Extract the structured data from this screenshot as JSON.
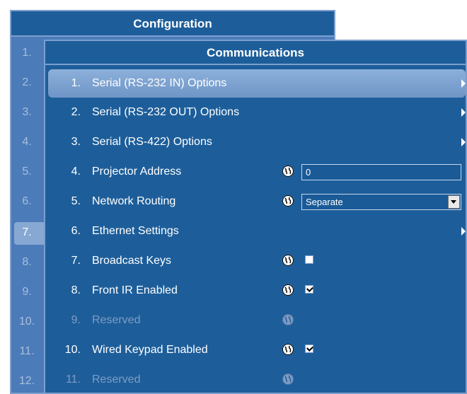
{
  "config_panel": {
    "title": "Configuration",
    "row_numbers": [
      "1.",
      "2.",
      "3.",
      "4.",
      "5.",
      "6.",
      "7.",
      "8.",
      "9.",
      "10.",
      "11.",
      "12."
    ],
    "highlighted_row": "7."
  },
  "comm_panel": {
    "title": "Communications",
    "rows": [
      {
        "num": "1.",
        "label": "Serial (RS-232 IN) Options",
        "submenu": true,
        "selected": true
      },
      {
        "num": "2.",
        "label": "Serial (RS-232 OUT) Options",
        "submenu": true
      },
      {
        "num": "3.",
        "label": "Serial (RS-422) Options",
        "submenu": true
      },
      {
        "num": "4.",
        "label": "Projector Address",
        "globe": true,
        "input_value": "0"
      },
      {
        "num": "5.",
        "label": "Network Routing",
        "globe": true,
        "select_value": "Separate"
      },
      {
        "num": "6.",
        "label": "Ethernet Settings",
        "submenu": true
      },
      {
        "num": "7.",
        "label": "Broadcast Keys",
        "globe": true,
        "checked": false
      },
      {
        "num": "8.",
        "label": "Front IR Enabled",
        "globe": true,
        "checked": true
      },
      {
        "num": "9.",
        "label": "Reserved",
        "globe": true,
        "disabled": true
      },
      {
        "num": "10.",
        "label": "Wired Keypad Enabled",
        "globe": true,
        "checked": true
      },
      {
        "num": "11.",
        "label": "Reserved",
        "globe": true,
        "disabled": true
      }
    ]
  },
  "icons": {
    "globe": "globe-icon",
    "submenu": "chevron-right-icon",
    "dropdown": "chevron-down-icon"
  },
  "colors": {
    "panel": "#1d5e9a",
    "panel_back": "#4b7bb8",
    "highlight": "#87a8d3",
    "border": "#7c9fce",
    "disabled_text": "#7f9cc4"
  }
}
